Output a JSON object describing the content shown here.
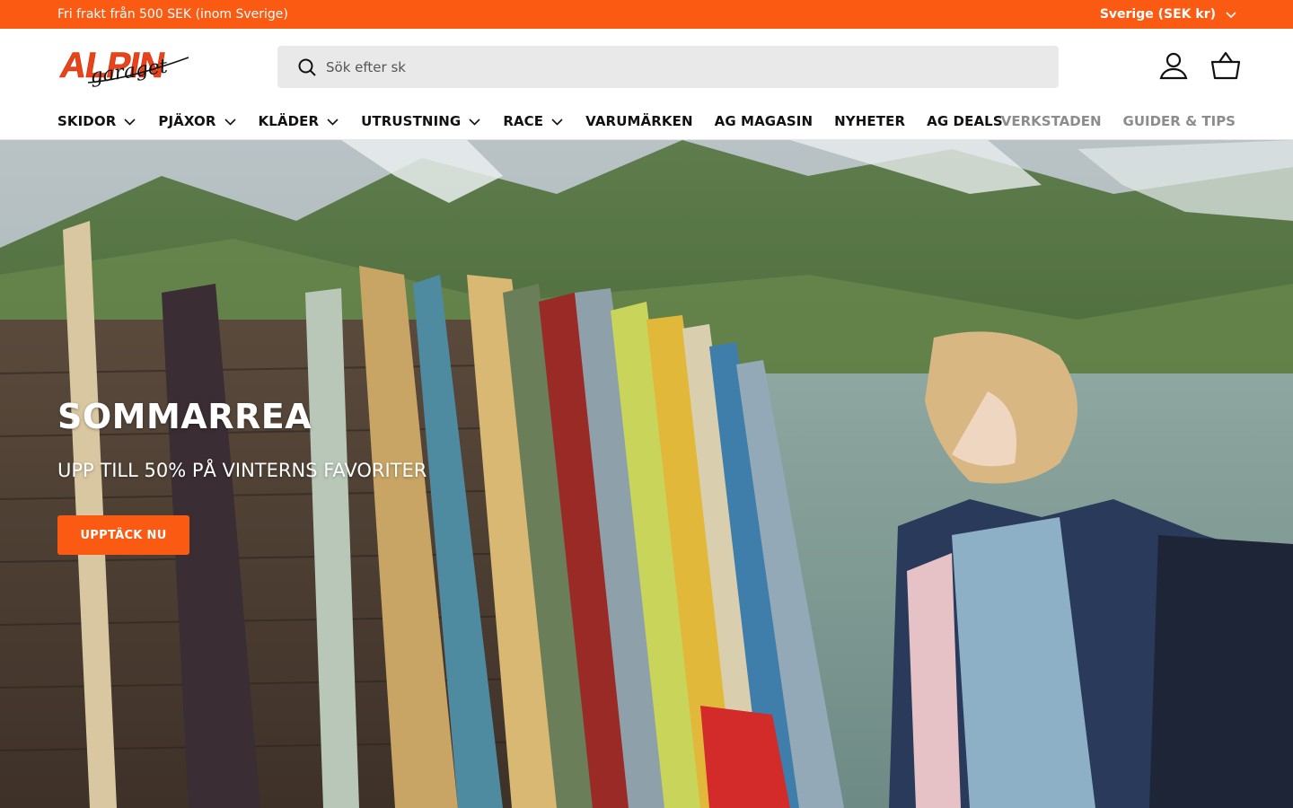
{
  "announcement": {
    "message": "Fri frakt från 500 SEK (inom Sverige)",
    "country_selector": "Sverige (SEK kr)"
  },
  "header": {
    "logo_top": "ALPIN",
    "logo_bottom": "garaget",
    "search_placeholder": "Sök efter sk"
  },
  "nav": {
    "left": [
      {
        "label": "SKIDOR",
        "has_dropdown": true
      },
      {
        "label": "PJÄXOR",
        "has_dropdown": true
      },
      {
        "label": "KLÄDER",
        "has_dropdown": true
      },
      {
        "label": "UTRUSTNING",
        "has_dropdown": true
      },
      {
        "label": "RACE",
        "has_dropdown": true
      },
      {
        "label": "VARUMÄRKEN",
        "has_dropdown": false
      },
      {
        "label": "AG MAGASIN",
        "has_dropdown": false
      },
      {
        "label": "NYHETER",
        "has_dropdown": false
      },
      {
        "label": "AG DEALS",
        "has_dropdown": false
      }
    ],
    "right": [
      {
        "label": "VERKSTADEN"
      },
      {
        "label": "GUIDER & TIPS"
      }
    ]
  },
  "hero": {
    "title": "SOMMARREA",
    "subtitle": "UPP TILL 50% PÅ VINTERNS FAVORITER",
    "cta": "UPPTÄCK NU"
  },
  "colors": {
    "brand_orange": "#fb5a13",
    "nav_secondary": "#8c8c8c",
    "search_bg": "#e9e9e9"
  },
  "icons": [
    "chevron-down-icon",
    "search-icon",
    "account-icon",
    "basket-icon"
  ]
}
